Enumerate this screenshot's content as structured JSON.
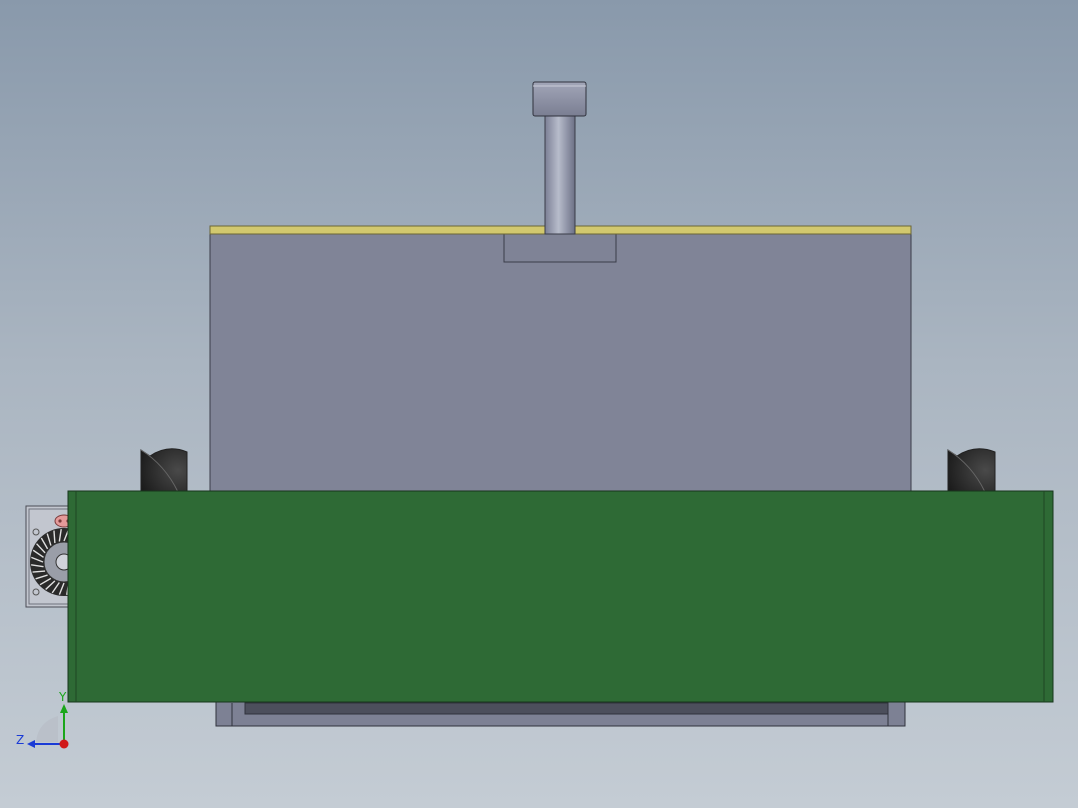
{
  "view": {
    "background_top": "#8999ab",
    "background_bottom": "#c4ccd4"
  },
  "model": {
    "housing_color": "#808497",
    "top_plate_color": "#d2c86e",
    "base_plate_color": "#2e6a35",
    "bolt_color": "#8e93a6",
    "motor_icon": "gear-motor-icon"
  },
  "triad": {
    "y_label": "Y",
    "z_label": "Z",
    "y_color": "#1aa61a",
    "z_color": "#1a3bd6",
    "x_color": "#d01818"
  }
}
